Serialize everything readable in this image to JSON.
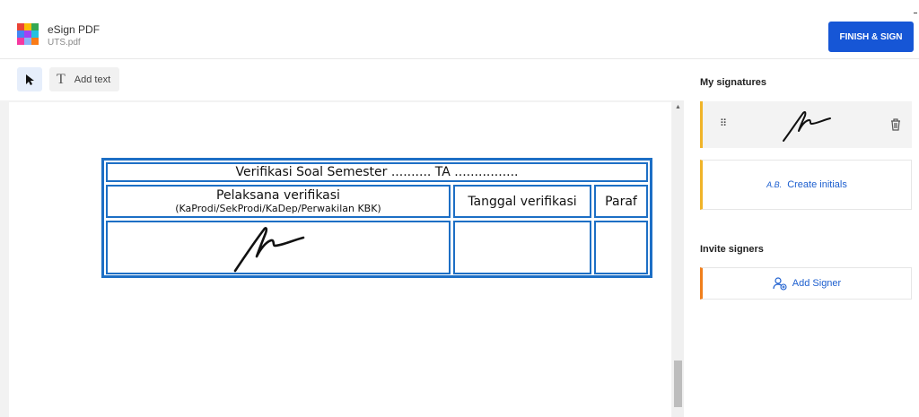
{
  "header": {
    "app_name": "eSign PDF",
    "file_name": "UTS.pdf",
    "finish_label": "FINISH & SIGN"
  },
  "toolbar": {
    "add_text_label": "Add text",
    "text_tool_glyph": "T",
    "select_tool_icon": "cursor-arrow-icon"
  },
  "form": {
    "title": "Verifikasi Soal Semester .......... TA ................",
    "pelaksana_line1": "Pelaksana verifikasi",
    "pelaksana_line2": "(KaProdi/SekProdi/KaDep/Perwakilan KBK)",
    "tanggal": "Tanggal verifikasi",
    "paraf": "Paraf"
  },
  "panel": {
    "my_signatures_title": "My signatures",
    "drag_glyph": "⠿",
    "initials_glyph": "A.B.",
    "create_initials_label": "Create initials",
    "invite_signers_title": "Invite signers",
    "add_signer_label": "Add Signer"
  },
  "colors": {
    "accent": "#1656d6",
    "form_border": "#1d6fc5",
    "signature_accent": "#f0b429",
    "signer_accent": "#f07f1d"
  }
}
